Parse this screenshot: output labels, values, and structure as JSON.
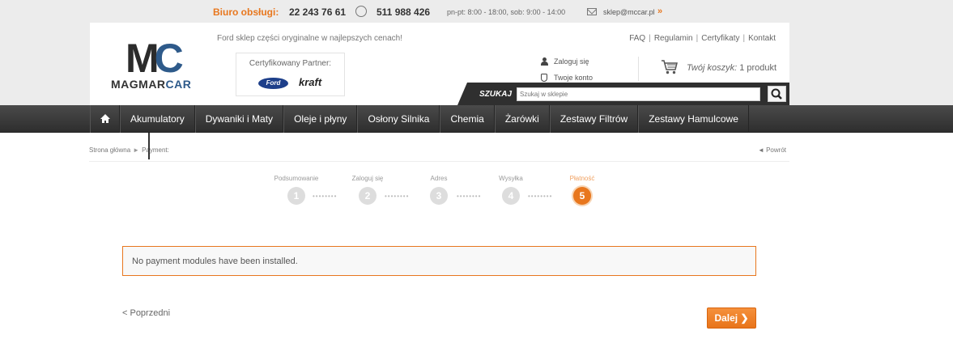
{
  "topbar": {
    "label": "Biuro obsługi:",
    "phone1": "22 243 76 61",
    "phone2": "511 988 426",
    "hours": "pn-pt: 8:00 - 18:00, sob: 9:00 - 14:00",
    "email": "sklep@mccar.pl",
    "arrows": "»"
  },
  "header": {
    "logo_mc_m": "M",
    "logo_mc_c": "C",
    "logo_text_a": "MAGMAR",
    "logo_text_b": "CAR",
    "tagline": "Ford sklep części oryginalne w najlepszych cenach!",
    "partner_label": "Certyfikowany Partner:",
    "ford_logo": "Ford",
    "kraft_logo": "kraft",
    "links": [
      "FAQ",
      "Regulamin",
      "Certyfikaty",
      "Kontakt"
    ],
    "login": "Zaloguj się",
    "account": "Twoje konto",
    "cart_label": "Twój koszyk:",
    "cart_count": "1 produkt",
    "search_label": "SZUKAJ",
    "search_placeholder": "Szukaj w sklepie"
  },
  "nav": {
    "items": [
      "Akumulatory",
      "Dywaniki i Maty",
      "Oleje i płyny",
      "Osłony Silnika",
      "Chemia",
      "Żarówki",
      "Zestawy Filtrów",
      "Zestawy Hamulcowe"
    ]
  },
  "breadcrumb": {
    "home": "Strona główna",
    "arrow": "►",
    "current": "Payment:",
    "back": "◄ Powrót"
  },
  "steps": [
    {
      "label": "Podsumowanie",
      "num": "1",
      "active": false
    },
    {
      "label": "Zaloguj się",
      "num": "2",
      "active": false
    },
    {
      "label": "Adres",
      "num": "3",
      "active": false
    },
    {
      "label": "Wysyłka",
      "num": "4",
      "active": false
    },
    {
      "label": "Płatność",
      "num": "5",
      "active": true
    }
  ],
  "step_dots": "••••••••",
  "alert": "No payment modules have been installed.",
  "prev_label": "< Poprzedni",
  "next_label": "Dalej ❯",
  "colors": {
    "accent": "#e8771e",
    "nav_bg": "#3a3a3a",
    "brand_blue": "#2e5a8a"
  }
}
